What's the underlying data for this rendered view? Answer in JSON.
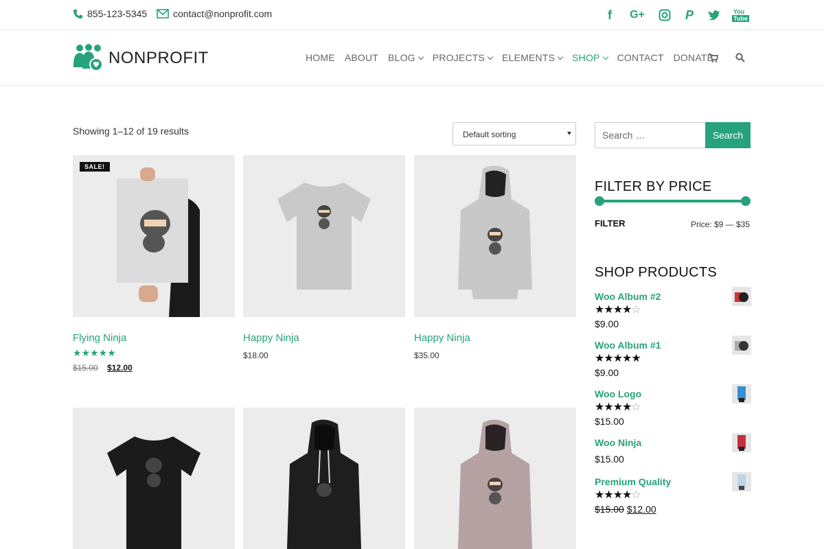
{
  "topbar": {
    "phone": "855-123-5345",
    "email": "contact@nonprofit.com",
    "social": [
      "facebook-icon",
      "google-plus-icon",
      "instagram-icon",
      "paypal-icon",
      "twitter-icon",
      "youtube-icon"
    ]
  },
  "brand": {
    "name": "NONPROFIT",
    "accent": "#26a27c"
  },
  "nav": {
    "home": "HOME",
    "about": "ABOUT",
    "blog": "BLOG",
    "projects": "PROJECTS",
    "elements": "ELEMENTS",
    "shop": "SHOP",
    "contact": "CONTACT",
    "donate": "DONATE"
  },
  "shop": {
    "results": "Showing 1–12 of 19 results",
    "sort": "Default sorting",
    "products": [
      {
        "name": "Flying Ninja",
        "rating": "5",
        "old_price": "$15.00",
        "price": "$12.00",
        "sale": "SALE!"
      },
      {
        "name": "Happy Ninja",
        "price": "$18.00"
      },
      {
        "name": "Happy Ninja",
        "price": "$35.00"
      }
    ]
  },
  "sidebar": {
    "search_placeholder": "Search …",
    "search_button": "Search",
    "filter_title": "FILTER BY PRICE",
    "filter_button": "FILTER",
    "price_range": "Price: $9 — $35",
    "shop_title": "SHOP PRODUCTS",
    "items": [
      {
        "name": "Woo Album #2",
        "rating": "4",
        "price": "$9.00"
      },
      {
        "name": "Woo Album #1",
        "rating": "5",
        "price": "$9.00"
      },
      {
        "name": "Woo Logo",
        "rating": "4",
        "price": "$15.00"
      },
      {
        "name": "Woo Ninja",
        "price": "$15.00"
      },
      {
        "name": "Premium Quality",
        "rating": "4",
        "old_price": "$15.00",
        "price": "$12.00"
      }
    ]
  }
}
